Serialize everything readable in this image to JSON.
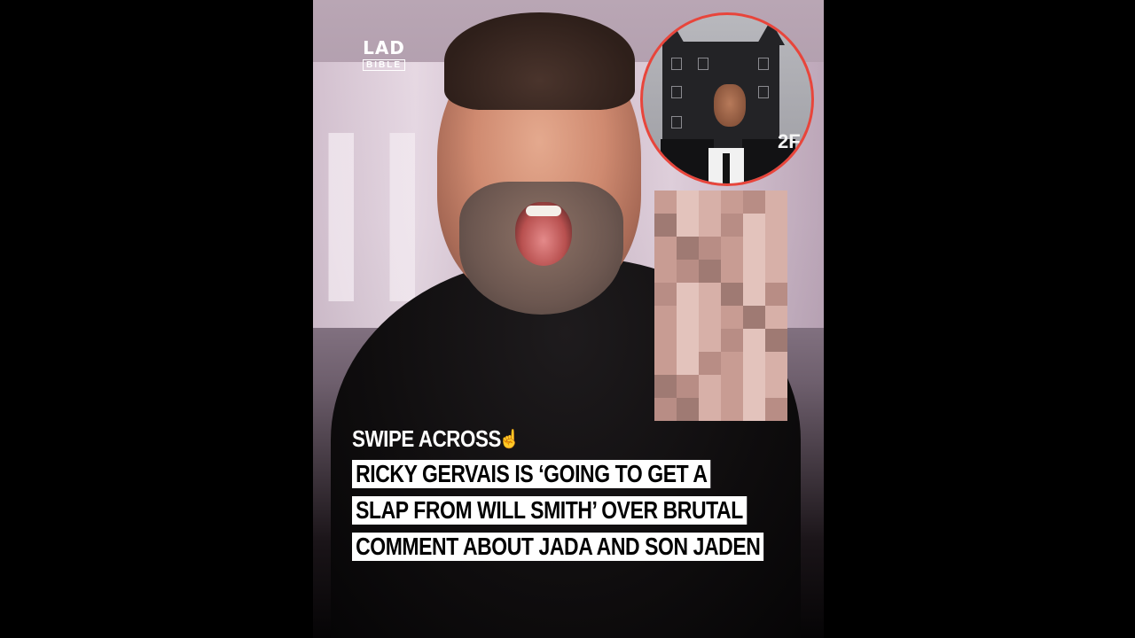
{
  "brand": {
    "logo_top": "LAD",
    "logo_bottom": "BIBLE"
  },
  "overlay": {
    "swipe_label": "SWIPE ACROSS",
    "swipe_icon": "☝"
  },
  "headline": {
    "lines": [
      "RICKY GERVAIS IS ‘GOING TO GET A",
      "SLAP FROM WILL SMITH’ OVER BRUTAL",
      "COMMENT ABOUT JADA AND SON JADEN"
    ]
  },
  "inset": {
    "sign_text": "2F",
    "border_color": "#e8453b"
  },
  "colors": {
    "background": "#000000",
    "caption_bg": "#ffffff",
    "caption_text": "#000000"
  }
}
